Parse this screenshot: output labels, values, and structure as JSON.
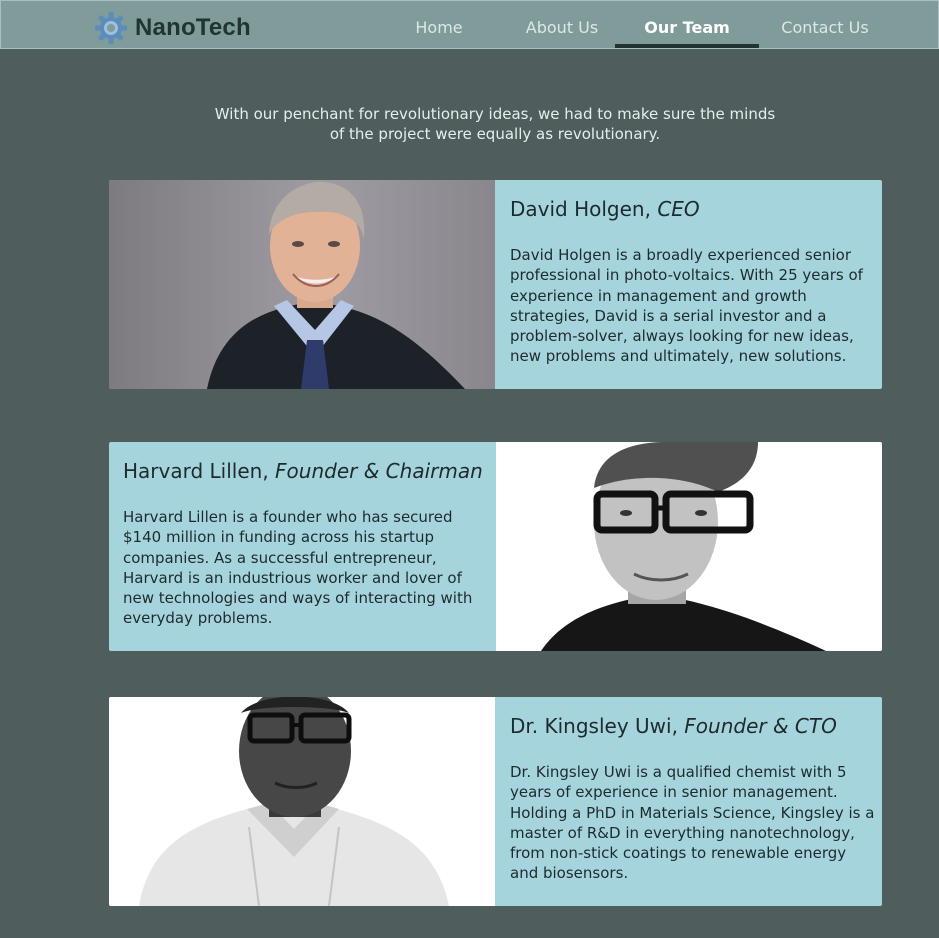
{
  "brand": {
    "name": "NanoTech",
    "logo_icon": "gear-icon",
    "logo_color": "#4f7fae"
  },
  "nav": {
    "items": [
      {
        "label": "Home",
        "active": false
      },
      {
        "label": "About Us",
        "active": false
      },
      {
        "label": "Our Team",
        "active": true
      },
      {
        "label": "Contact Us",
        "active": false
      }
    ]
  },
  "intro": {
    "line1": "With our penchant for revolutionary ideas, we had to make sure the minds",
    "line2": "of the project were equally as revolutionary."
  },
  "team": [
    {
      "name": "David Holgen,",
      "role": "CEO",
      "bio": "David Holgen is a broadly experienced senior professional in photo-voltaics. With 25 years of experience in management and growth strategies, David is a serial investor and a problem-solver, always looking for new ideas, new problems and ultimately, new solutions."
    },
    {
      "name": "Harvard Lillen,",
      "role": "Founder & Chairman",
      "bio": "Harvard Lillen is a founder who has secured $140 million in funding across his startup companies. As a successful entrepreneur, Harvard is an industrious worker and lover of new technologies and ways of interacting with everyday problems."
    },
    {
      "name": "Dr. Kingsley Uwi,",
      "role": "Founder & CTO",
      "bio": "Dr. Kingsley Uwi is a qualified chemist with 5 years of experience in senior management. Holding a PhD in Materials Science, Kingsley is a master of R&D in everything nanotechnology, from non-stick coatings to renewable energy and biosensors."
    }
  ],
  "colors": {
    "page_bg": "#4f5d5d",
    "header_bg": "#7f9c9b",
    "card_bg": "#a6d4dc",
    "active_underline": "#203431"
  }
}
